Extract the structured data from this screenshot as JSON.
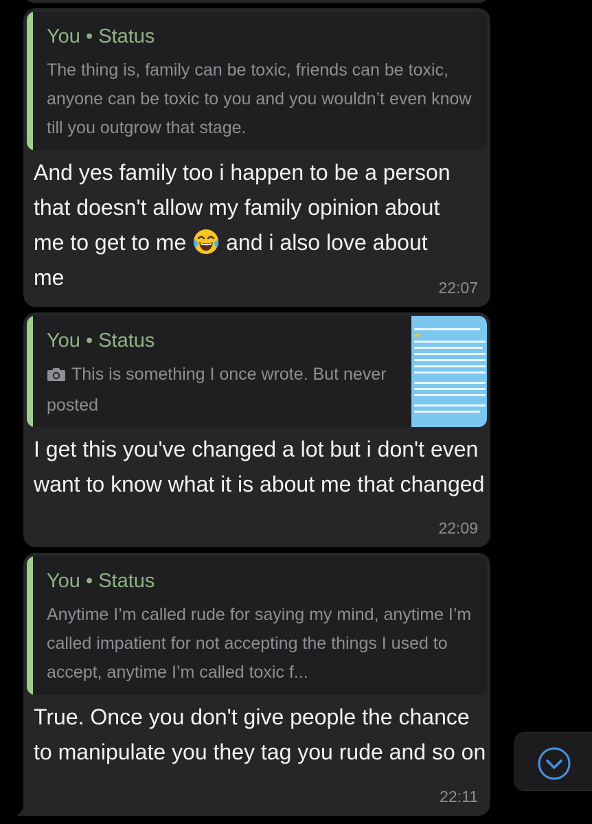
{
  "messages": [
    {
      "reply": {
        "sender": "You • Status",
        "text": "The thing is, family can be toxic, friends can be toxic, anyone can be toxic to you and you wouldn’t even know till you outgrow that stage."
      },
      "text_before_emoji": "And yes family too i happen to be a person that doesn't allow my family opinion about me to get to me ",
      "emoji": "face-with-tears-of-joy",
      "text_after_emoji": " and i also love about me",
      "time": "22:07"
    },
    {
      "reply": {
        "sender": "You • Status",
        "media_icon": "camera-icon",
        "text": "This is something I once wrote. But never posted"
      },
      "text": "I get this you've changed a lot but i don't even want to know what it is about me that changed",
      "time": "22:09"
    },
    {
      "reply": {
        "sender": "You • Status",
        "text": "Anytime I’m called rude for saying my mind, anytime I’m called impatient for not accepting the things I used to accept, anytime I’m called toxic f..."
      },
      "text": "True. Once you don't give people the chance to manipulate you they tag you rude and so on",
      "time": "22:11"
    }
  ],
  "scroll_down_button": {
    "icon": "chevron-down-circle-icon"
  },
  "colors": {
    "background": "#000000",
    "bubble": "#262628",
    "quote_background": "#1f1f21",
    "quote_bar": "#9fcf8f",
    "quote_sender": "#8fb483",
    "secondary_text": "#8e8e93",
    "primary_text": "#f2f2f4",
    "accent_blue": "#4a90e2"
  }
}
